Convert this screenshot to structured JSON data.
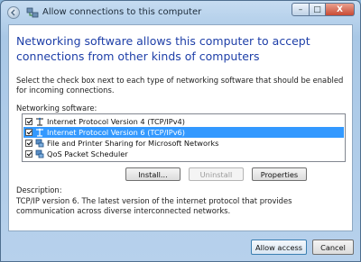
{
  "window": {
    "title": "Allow connections to this computer",
    "controls": {
      "minimize": "–",
      "maximize": "□",
      "close": "X"
    }
  },
  "heading": "Networking software allows this computer to accept connections from other kinds of computers",
  "instructions": "Select the check box next to each type of networking software that should be enabled for incoming connections.",
  "list_label": "Networking software:",
  "software_items": [
    {
      "label": "Internet Protocol Version 4 (TCP/IPv4)",
      "checked": true,
      "selected": false,
      "icon": "network-protocol-icon"
    },
    {
      "label": "Internet Protocol Version 6 (TCP/IPv6)",
      "checked": true,
      "selected": true,
      "icon": "network-protocol-icon"
    },
    {
      "label": "File and Printer Sharing for Microsoft Networks",
      "checked": true,
      "selected": false,
      "icon": "network-service-icon"
    },
    {
      "label": "QoS Packet Scheduler",
      "checked": true,
      "selected": false,
      "icon": "network-service-icon"
    }
  ],
  "buttons": {
    "install": "Install...",
    "uninstall": "Uninstall",
    "properties": "Properties"
  },
  "description_label": "Description:",
  "description_text": "TCP/IP version 6. The latest version of the internet protocol that provides communication across diverse interconnected networks.",
  "footer": {
    "allow": "Allow access",
    "cancel": "Cancel"
  },
  "colors": {
    "heading": "#1e3fa8",
    "selection": "#3399ff",
    "window_frame": "#a9c8e6"
  }
}
